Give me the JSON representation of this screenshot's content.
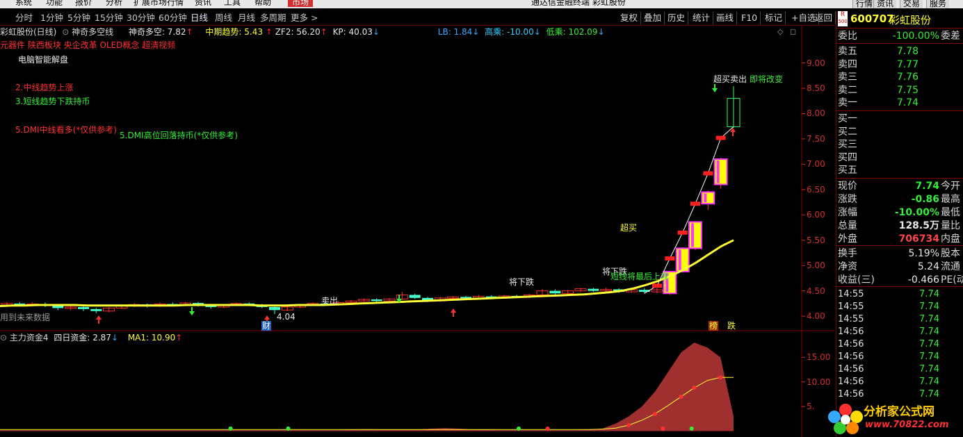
{
  "menu": {
    "items": [
      "系统",
      "功能",
      "报价",
      "分析",
      "扩展市场行情",
      "资讯",
      "工具",
      "帮助"
    ],
    "market": "市场",
    "window_title": "通达信金融终端 彩虹股份",
    "right_items": [
      "行情",
      "资讯",
      "交易",
      "服务"
    ]
  },
  "periods": [
    "分时",
    "1分钟",
    "5分钟",
    "15分钟",
    "30分钟",
    "60分钟",
    "日线",
    "周线",
    "月线",
    "多周期",
    "更多 >"
  ],
  "active_period": "日线",
  "tools": [
    "复权",
    "叠加",
    "历史",
    "统计",
    "画线",
    "F10",
    "标记",
    "+自选",
    "返回"
  ],
  "indicator_line": {
    "stock": "彩虹股份(日线)",
    "label1": "神奇多空线",
    "shenqi": "神奇多空: 7.82",
    "zhongqi": "中期趋势: 5.43",
    "zf2": "ZF2: 56.20",
    "kp": "KP: 40.03",
    "lb": "LB: 1.84",
    "gaocheng": "高乘: -10.00",
    "dicheng": "低乘: 102.09"
  },
  "concepts": "元器件 陕西板块 央企改革 OLED概念 超清视频",
  "notes": {
    "n1": "电脑智能解盘",
    "n2": "2.中线趋势上涨",
    "n3": "3.短线趋势下跌持币",
    "n4": "5.DMI中线看多(*仅供参考)",
    "n5": "5.DMI高位回落持币(*仅供参考)"
  },
  "annotations": {
    "sell1": "卖出",
    "jiangxiadie1": "将下跌",
    "jiangxiadie2": "将下跌",
    "zuihou": "短线将最后上攻",
    "chaomai": "超买",
    "top": "超买卖出",
    "top2": "即将改变",
    "future": "用到未来数据",
    "cai": "财",
    "low": "4.04",
    "bang": "榜",
    "die": "跌"
  },
  "price_axis": [
    "9.00",
    "8.50",
    "8.00",
    "7.50",
    "7.00",
    "6.50",
    "6.00",
    "5.50",
    "5.00",
    "4.50",
    "4.00"
  ],
  "sub_indicator": {
    "name": "主力资金4",
    "siri": "四日资金: 2.87",
    "ma1": "MA1: 10.90"
  },
  "sub_axis": [
    "15.00",
    "10.00",
    "5."
  ],
  "quote": {
    "r_badge": "R",
    "r_num": "500",
    "code": "600707",
    "name": "彩虹股份",
    "weibi_label": "委比",
    "weibi": "-100.00%",
    "weicha_label": "委差",
    "sells": [
      {
        "label": "卖五",
        "price": "7.78"
      },
      {
        "label": "卖四",
        "price": "7.77"
      },
      {
        "label": "卖三",
        "price": "7.76"
      },
      {
        "label": "卖二",
        "price": "7.75"
      },
      {
        "label": "卖一",
        "price": "7.74"
      }
    ],
    "buys": [
      "买一",
      "买二",
      "买三",
      "买四",
      "买五"
    ],
    "stats": [
      {
        "l": "现价",
        "v": "7.74",
        "c": "#33ee33",
        "r": "今开"
      },
      {
        "l": "涨跌",
        "v": "-0.86",
        "c": "#33ee33",
        "r": "最高"
      },
      {
        "l": "涨幅",
        "v": "-10.00%",
        "c": "#33ee33",
        "r": "最低"
      },
      {
        "l": "总量",
        "v": "128.5万",
        "c": "#e8e8e8",
        "r": "量比"
      },
      {
        "l": "外盘",
        "v": "706734",
        "c": "#ff4444",
        "r": "内盘"
      }
    ],
    "stats2": [
      {
        "l": "换手",
        "v": "5.19%",
        "c": "#e8e8e8",
        "r": "股本"
      },
      {
        "l": "净资",
        "v": "5.24",
        "c": "#e8e8e8",
        "r": "流通"
      },
      {
        "l": "收益(三)",
        "v": "-0.466",
        "c": "#e8e8e8",
        "r": "PE(动)"
      }
    ],
    "ticks": [
      {
        "t": "14:55",
        "p": "7.74"
      },
      {
        "t": "14:55",
        "p": "7.74"
      },
      {
        "t": "14:55",
        "p": "7.74"
      },
      {
        "t": "14:56",
        "p": "7.74"
      },
      {
        "t": "14:56",
        "p": "7.74"
      },
      {
        "t": "14:56",
        "p": "7.74"
      },
      {
        "t": "14:56",
        "p": "7.74"
      },
      {
        "t": "14:56",
        "p": "7.74"
      },
      {
        "t": "14:56",
        "p": "7.74"
      }
    ]
  },
  "watermark": {
    "site": "分析家公式网",
    "url": "www.70822.com"
  },
  "chart_data": {
    "type": "candlestick",
    "candles": [
      {
        "o": 4.22,
        "c": 4.25,
        "h": 4.28,
        "l": 4.18
      },
      {
        "o": 4.25,
        "c": 4.22,
        "h": 4.28,
        "l": 4.2
      },
      {
        "o": 4.22,
        "c": 4.24,
        "h": 4.27,
        "l": 4.19
      },
      {
        "o": 4.24,
        "c": 4.2,
        "h": 4.27,
        "l": 4.18
      },
      {
        "o": 4.2,
        "c": 4.16,
        "h": 4.22,
        "l": 4.12
      },
      {
        "o": 4.16,
        "c": 4.18,
        "h": 4.2,
        "l": 4.12
      },
      {
        "o": 4.18,
        "c": 4.14,
        "h": 4.2,
        "l": 4.1
      },
      {
        "o": 4.14,
        "c": 4.1,
        "h": 4.16,
        "l": 4.06
      },
      {
        "o": 4.1,
        "c": 4.16,
        "h": 4.18,
        "l": 4.08
      },
      {
        "o": 4.16,
        "c": 4.2,
        "h": 4.22,
        "l": 4.14
      },
      {
        "o": 4.2,
        "c": 4.23,
        "h": 4.26,
        "l": 4.18
      },
      {
        "o": 4.23,
        "c": 4.2,
        "h": 4.25,
        "l": 4.17
      },
      {
        "o": 4.2,
        "c": 4.24,
        "h": 4.27,
        "l": 4.18
      },
      {
        "o": 4.24,
        "c": 4.22,
        "h": 4.27,
        "l": 4.2
      },
      {
        "o": 4.22,
        "c": 4.26,
        "h": 4.28,
        "l": 4.2
      },
      {
        "o": 4.26,
        "c": 4.21,
        "h": 4.28,
        "l": 4.19
      },
      {
        "o": 4.21,
        "c": 4.18,
        "h": 4.23,
        "l": 4.15
      },
      {
        "o": 4.18,
        "c": 4.22,
        "h": 4.24,
        "l": 4.16
      },
      {
        "o": 4.22,
        "c": 4.25,
        "h": 4.27,
        "l": 4.2
      },
      {
        "o": 4.25,
        "c": 4.22,
        "h": 4.27,
        "l": 4.2
      },
      {
        "o": 4.22,
        "c": 4.18,
        "h": 4.24,
        "l": 4.16
      },
      {
        "o": 4.18,
        "c": 4.12,
        "h": 4.2,
        "l": 4.04
      },
      {
        "o": 4.12,
        "c": 4.18,
        "h": 4.2,
        "l": 4.1
      },
      {
        "o": 4.18,
        "c": 4.22,
        "h": 4.24,
        "l": 4.16
      },
      {
        "o": 4.22,
        "c": 4.25,
        "h": 4.27,
        "l": 4.2
      },
      {
        "o": 4.25,
        "c": 4.23,
        "h": 4.27,
        "l": 4.21
      },
      {
        "o": 4.23,
        "c": 4.27,
        "h": 4.3,
        "l": 4.21
      },
      {
        "o": 4.27,
        "c": 4.3,
        "h": 4.32,
        "l": 4.25
      },
      {
        "o": 4.3,
        "c": 4.33,
        "h": 4.35,
        "l": 4.28
      },
      {
        "o": 4.33,
        "c": 4.3,
        "h": 4.35,
        "l": 4.28
      },
      {
        "o": 4.3,
        "c": 4.34,
        "h": 4.36,
        "l": 4.28
      },
      {
        "o": 4.34,
        "c": 4.42,
        "h": 4.48,
        "l": 4.32
      },
      {
        "o": 4.42,
        "c": 4.36,
        "h": 4.44,
        "l": 4.34
      },
      {
        "o": 4.36,
        "c": 4.3,
        "h": 4.38,
        "l": 4.28
      },
      {
        "o": 4.3,
        "c": 4.36,
        "h": 4.38,
        "l": 4.28
      },
      {
        "o": 4.36,
        "c": 4.38,
        "h": 4.4,
        "l": 4.34
      },
      {
        "o": 4.38,
        "c": 4.36,
        "h": 4.4,
        "l": 4.34
      },
      {
        "o": 4.36,
        "c": 4.39,
        "h": 4.42,
        "l": 4.35
      },
      {
        "o": 4.39,
        "c": 4.37,
        "h": 4.41,
        "l": 4.35
      },
      {
        "o": 4.37,
        "c": 4.4,
        "h": 4.42,
        "l": 4.35
      },
      {
        "o": 4.4,
        "c": 4.38,
        "h": 4.42,
        "l": 4.36
      },
      {
        "o": 4.38,
        "c": 4.42,
        "h": 4.44,
        "l": 4.36
      },
      {
        "o": 4.42,
        "c": 4.5,
        "h": 4.54,
        "l": 4.4
      },
      {
        "o": 4.5,
        "c": 4.45,
        "h": 4.53,
        "l": 4.43
      },
      {
        "o": 4.45,
        "c": 4.5,
        "h": 4.52,
        "l": 4.43
      },
      {
        "o": 4.5,
        "c": 4.54,
        "h": 4.56,
        "l": 4.47
      },
      {
        "o": 4.54,
        "c": 4.5,
        "h": 4.56,
        "l": 4.48
      },
      {
        "o": 4.5,
        "c": 4.53,
        "h": 4.56,
        "l": 4.48
      },
      {
        "o": 4.53,
        "c": 4.48,
        "h": 4.55,
        "l": 4.46
      },
      {
        "o": 4.48,
        "c": 4.52,
        "h": 4.55,
        "l": 4.46
      },
      {
        "o": 4.52,
        "c": 4.48,
        "h": 4.55,
        "l": 4.46
      },
      {
        "o": 4.48,
        "c": 4.52,
        "h": 4.55,
        "l": 4.45
      },
      {
        "o": 4.45,
        "c": 4.88,
        "h": 4.9,
        "l": 4.42
      },
      {
        "o": 4.88,
        "c": 5.34,
        "h": 5.36,
        "l": 4.86
      },
      {
        "o": 5.34,
        "c": 5.86,
        "h": 5.88,
        "l": 5.3
      },
      {
        "o": 6.22,
        "c": 6.45,
        "h": 6.48,
        "l": 6.1
      },
      {
        "o": 6.6,
        "c": 7.1,
        "h": 7.13,
        "l": 6.52
      },
      {
        "o": 7.74,
        "c": 8.3,
        "h": 8.54,
        "l": 7.72
      }
    ],
    "ma_yellow": [
      4.2,
      4.21,
      4.21,
      4.22,
      4.22,
      4.22,
      4.22,
      4.21,
      4.21,
      4.21,
      4.21,
      4.21,
      4.21,
      4.21,
      4.21,
      4.22,
      4.22,
      4.22,
      4.22,
      4.22,
      4.22,
      4.21,
      4.21,
      4.21,
      4.22,
      4.22,
      4.22,
      4.23,
      4.24,
      4.25,
      4.26,
      4.27,
      4.28,
      4.29,
      4.3,
      4.31,
      4.32,
      4.33,
      4.34,
      4.35,
      4.36,
      4.37,
      4.38,
      4.39,
      4.4,
      4.41,
      4.42,
      4.43,
      4.45,
      4.47,
      4.5,
      4.55,
      4.62,
      4.7,
      4.8,
      4.92,
      5.06,
      5.22,
      5.38,
      5.5
    ],
    "white_line": [
      4.45,
      4.6,
      5.14,
      5.65,
      6.22,
      6.82,
      7.52,
      7.74
    ],
    "ylim": [
      3.85,
      9.2
    ],
    "sub": {
      "red_area": [
        0.2,
        0.2,
        0.2,
        0.2,
        0.2,
        0.2,
        0.2,
        0.2,
        0.2,
        0.2,
        0.2,
        0.2,
        0.2,
        0.2,
        0.2,
        0.2,
        0.2,
        0.2,
        0.2,
        0.2,
        0.2,
        0.2,
        0.2,
        0.2,
        0.2,
        0.2,
        0.2,
        0.3,
        0.4,
        0.3,
        0.3,
        0.3,
        0.3,
        0.5,
        0.6,
        0.5,
        0.3,
        0.3,
        0.2,
        0.2,
        0.2,
        0.2,
        0.2,
        0.2,
        0.2,
        0.3,
        0.5,
        1.5,
        3,
        5,
        8,
        12,
        16,
        18,
        17,
        15,
        3
      ],
      "ma1": [
        0.3,
        0.3,
        0.3,
        0.3,
        0.3,
        0.3,
        0.3,
        0.3,
        0.3,
        0.3,
        0.3,
        0.3,
        0.3,
        0.3,
        0.3,
        0.3,
        0.3,
        0.3,
        0.3,
        0.3,
        0.3,
        0.3,
        0.3,
        0.3,
        0.3,
        0.3,
        0.3,
        0.3,
        0.3,
        0.3,
        0.3,
        0.3,
        0.3,
        0.3,
        0.3,
        0.3,
        0.3,
        0.3,
        0.3,
        0.3,
        0.3,
        0.3,
        0.3,
        0.3,
        0.3,
        0.3,
        0.4,
        0.6,
        1.2,
        2.2,
        3.5,
        5.2,
        7,
        8.8,
        10.3,
        10.9,
        10.9
      ],
      "ylim": [
        -0.5,
        19
      ]
    }
  }
}
